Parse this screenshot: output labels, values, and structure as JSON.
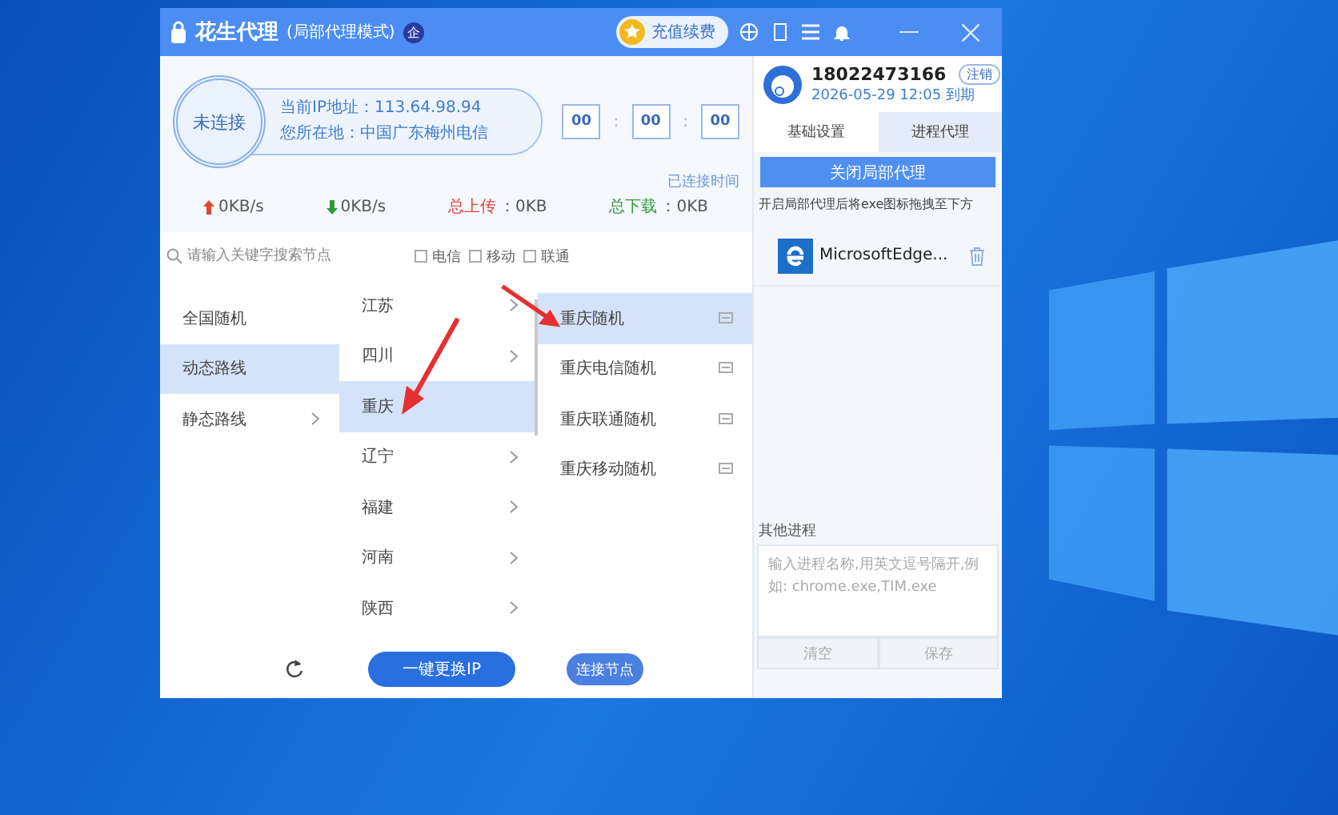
{
  "app": {
    "title": "花生代理",
    "mode": "(局部代理模式)",
    "badge": "企",
    "recharge_button": "充值续费"
  },
  "connection": {
    "status": "未连接",
    "ip_line": "当前IP地址：113.64.98.94",
    "location_line": "您所在地：中国广东梅州电信",
    "timer": [
      "00",
      "00",
      "00"
    ],
    "timer_separator": ":",
    "timer_label": "已连接时间"
  },
  "stats": [
    {
      "kind": "upload",
      "value": "0KB/s"
    },
    {
      "kind": "download",
      "value": "0KB/s"
    },
    {
      "kind": "total_upload",
      "label": "总上传",
      "value": "：0KB"
    },
    {
      "kind": "total_download",
      "label": "总下载",
      "value": "：0KB"
    }
  ],
  "search": {
    "placeholder": "请输入关键字搜索节点"
  },
  "isp_filters": [
    {
      "label": "电信",
      "checked": false
    },
    {
      "label": "移动",
      "checked": false
    },
    {
      "label": "联通",
      "checked": false
    }
  ],
  "route_types": [
    {
      "label": "全国随机",
      "selected": false,
      "expandable": false
    },
    {
      "label": "动态路线",
      "selected": true,
      "expandable": false
    },
    {
      "label": "静态路线",
      "selected": false,
      "expandable": true
    }
  ],
  "provinces": [
    {
      "label": "江苏",
      "selected": false
    },
    {
      "label": "四川",
      "selected": false
    },
    {
      "label": "重庆",
      "selected": true
    },
    {
      "label": "辽宁",
      "selected": false
    },
    {
      "label": "福建",
      "selected": false
    },
    {
      "label": "河南",
      "selected": false
    },
    {
      "label": "陕西",
      "selected": false
    }
  ],
  "nodes": [
    {
      "label": "重庆随机",
      "selected": true
    },
    {
      "label": "重庆电信随机",
      "selected": false
    },
    {
      "label": "重庆联通随机",
      "selected": false
    },
    {
      "label": "重庆移动随机",
      "selected": false
    }
  ],
  "bottom_buttons": {
    "change_ip": "一键更换IP",
    "connect": "连接节点"
  },
  "account": {
    "phone": "18022473166",
    "logout": "注销",
    "expiry": "2026-05-29 12:05 到期"
  },
  "tabs": [
    {
      "label": "基础设置",
      "selected": true
    },
    {
      "label": "进程代理",
      "selected": false
    }
  ],
  "close_proxy_button": "关闭局部代理",
  "hint": "开启局部代理后将exe图标拖拽至下方",
  "apps": [
    {
      "name": "MicrosoftEdge..."
    }
  ],
  "other_processes": {
    "label": "其他进程",
    "placeholder": "输入进程名称,用英文逗号隔开,例如: chrome.exe,TIM.exe",
    "buttons": [
      "清空",
      "保存"
    ]
  }
}
